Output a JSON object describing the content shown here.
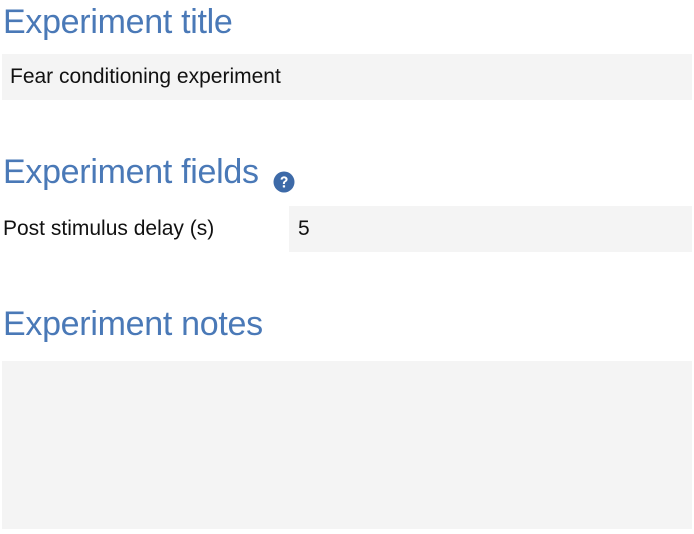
{
  "sections": {
    "title": {
      "heading": "Experiment title",
      "value": "Fear conditioning experiment"
    },
    "fields": {
      "heading": "Experiment fields",
      "help_icon": "question-circle-icon",
      "items": [
        {
          "label": "Post stimulus delay (s)",
          "value": "5"
        }
      ]
    },
    "notes": {
      "heading": "Experiment notes",
      "value": ""
    }
  },
  "colors": {
    "heading": "#4a79b7",
    "input_bg": "#f4f4f4",
    "help_icon": "#3d6aa8"
  }
}
